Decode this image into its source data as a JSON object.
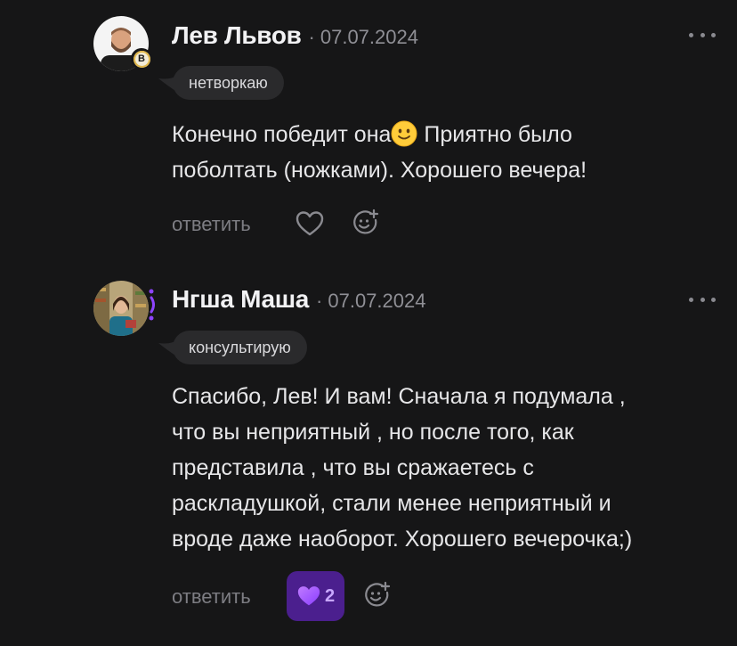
{
  "comments": [
    {
      "author": "Лев Львов",
      "date": "07.07.2024",
      "separator": "·",
      "badge_letter": "B",
      "tag": "нетворкаю",
      "text_lines": [
        "Конечно победит она",
        "поболтать (ножками). Хорошего вечера!"
      ],
      "text_after_emoji": " Приятно было",
      "emoji": "slightly-smiling-face",
      "reply_label": "ответить",
      "liked": false
    },
    {
      "author": "Нгша Маша",
      "date": "07.07.2024",
      "separator": "·",
      "tag": "консультирую",
      "text_lines": [
        "Спасибо, Лев! И вам! Сначала я подумала ,",
        "что вы неприятный , но после того, как",
        "представила , что вы сражаетесь с",
        "раскладушкой, стали менее неприятный и",
        "вроде даже наоборот. Хорошего вечерочка;)"
      ],
      "reply_label": "ответить",
      "liked": true,
      "like_count": "2"
    }
  ],
  "colors": {
    "background": "#161617",
    "tag_bg": "#2a2a2c",
    "muted": "#7d7d83",
    "like_active_bg": "#4b1f8e",
    "like_active_heart": "#a259ff",
    "story_ring": "#8e44ff"
  },
  "icons": {
    "more": "more-horizontal-icon",
    "like": "heart-outline-icon",
    "liked": "heart-filled-icon",
    "react": "add-reaction-icon"
  }
}
